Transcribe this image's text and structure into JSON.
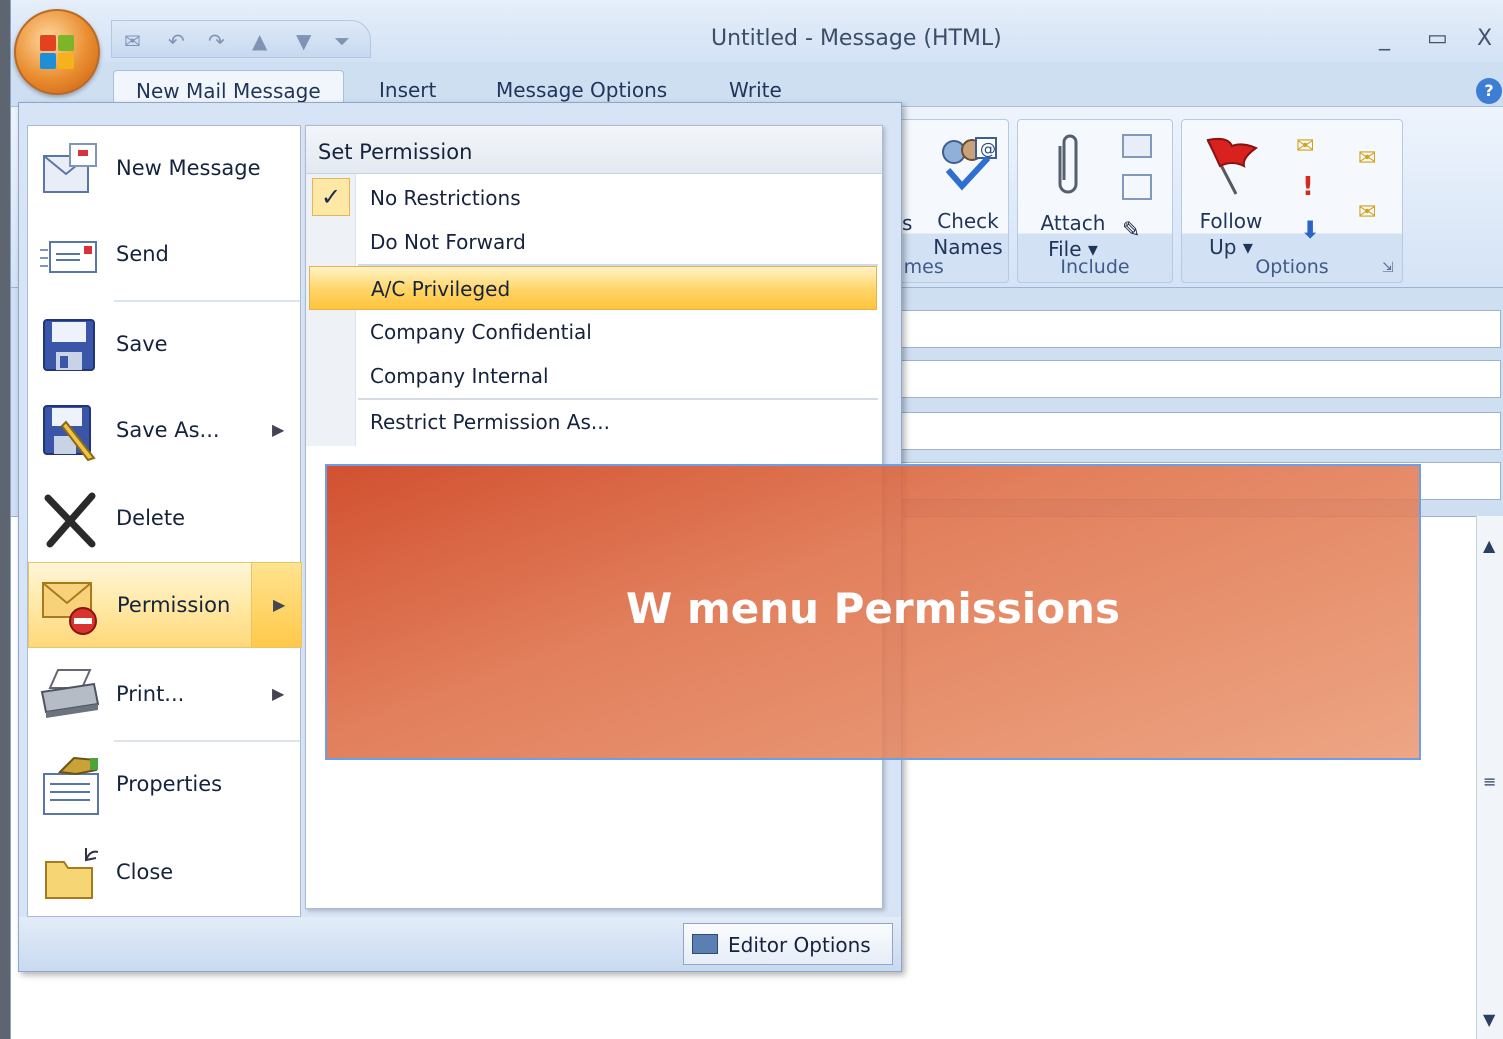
{
  "window": {
    "title": "Untitled - Message (HTML)",
    "controls": {
      "minimize": "_",
      "maximize": "▭",
      "close": "X"
    }
  },
  "tabs": [
    {
      "label": "New Mail Message",
      "active": true
    },
    {
      "label": "Insert"
    },
    {
      "label": "Message Options"
    },
    {
      "label": "Write"
    }
  ],
  "help": {
    "label": "?"
  },
  "ribbon": {
    "names_group": {
      "check_names": "Check\nNames",
      "label_fragment": "ames",
      "partial_text": "s"
    },
    "include_group": {
      "attach_file": "Attach\nFile ▾",
      "label": "Include"
    },
    "options_group": {
      "follow_up": "Follow\nUp ▾",
      "label": "Options"
    }
  },
  "office_menu": {
    "items": [
      {
        "label": "New Message",
        "icon": "new-message-icon"
      },
      {
        "label": "Send",
        "icon": "send-icon"
      },
      {
        "label": "Save",
        "icon": "save-icon"
      },
      {
        "label": "Save As...",
        "icon": "save-as-icon",
        "submenu": true
      },
      {
        "label": "Delete",
        "icon": "delete-icon"
      },
      {
        "label": "Permission",
        "icon": "permission-icon",
        "submenu": true,
        "active": true
      },
      {
        "label": "Print...",
        "icon": "print-icon",
        "submenu": true
      },
      {
        "label": "Properties",
        "icon": "properties-icon"
      },
      {
        "label": "Close",
        "icon": "close-folder-icon"
      }
    ],
    "permission_panel": {
      "header": "Set Permission",
      "options": [
        {
          "label": "No Restrictions",
          "checked": true
        },
        {
          "label": "Do Not Forward"
        },
        {
          "label": "A/C Privileged",
          "highlighted": true
        },
        {
          "label": "Company Confidential"
        },
        {
          "label": "Company Internal"
        },
        {
          "label": "Restrict Permission As..."
        }
      ]
    },
    "footer": {
      "editor_options": "Editor Options"
    }
  },
  "banner": {
    "text": "W menu Permissions"
  },
  "colors": {
    "banner": "#d9613a",
    "highlight": "#ffd466",
    "accent": "#3e7dd4"
  }
}
